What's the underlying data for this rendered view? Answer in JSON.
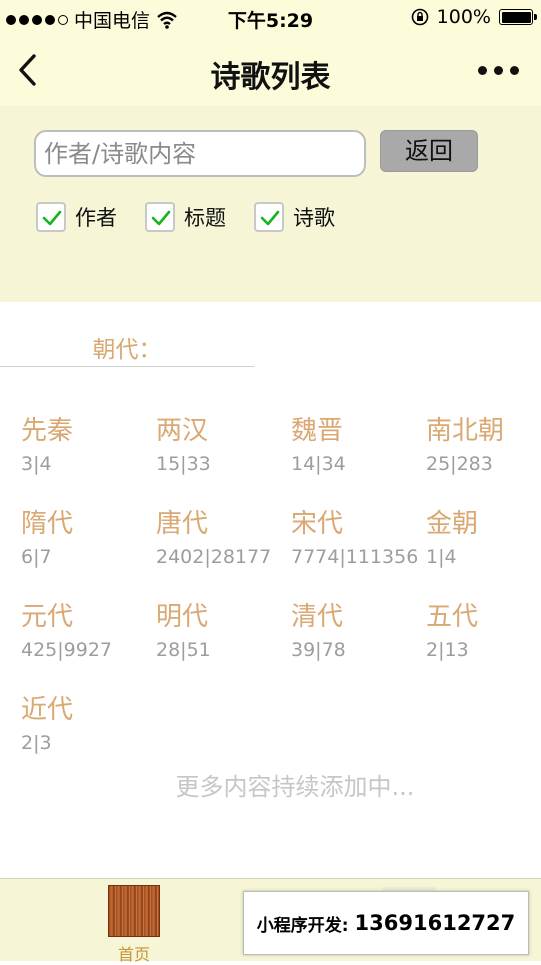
{
  "status_bar": {
    "carrier": "中国电信",
    "time": "下午5:29",
    "battery": "100%"
  },
  "nav": {
    "title": "诗歌列表"
  },
  "search": {
    "placeholder": "作者/诗歌内容",
    "value": "",
    "back_label": "返回"
  },
  "filters": [
    {
      "label": "作者",
      "checked": true
    },
    {
      "label": "标题",
      "checked": true
    },
    {
      "label": "诗歌",
      "checked": true
    }
  ],
  "dynasty": {
    "heading": "朝代：",
    "items": [
      {
        "name": "先秦",
        "count": "3|4"
      },
      {
        "name": "两汉",
        "count": "15|33"
      },
      {
        "name": "魏晋",
        "count": "14|34"
      },
      {
        "name": "南北朝",
        "count": "25|283"
      },
      {
        "name": "隋代",
        "count": "6|7"
      },
      {
        "name": "唐代",
        "count": "2402|28177"
      },
      {
        "name": "宋代",
        "count": "7774|111356"
      },
      {
        "name": "金朝",
        "count": "1|4"
      },
      {
        "name": "元代",
        "count": "425|9927"
      },
      {
        "name": "明代",
        "count": "28|51"
      },
      {
        "name": "清代",
        "count": "39|78"
      },
      {
        "name": "五代",
        "count": "2|13"
      },
      {
        "name": "近代",
        "count": "2|3"
      }
    ]
  },
  "footer_note": "更多内容持续添加中...",
  "tabbar": {
    "home_label": "首页"
  },
  "banner": {
    "prefix": "小程序开发:",
    "phone": "13691612727"
  },
  "colors": {
    "header_bg": "#fcfbda",
    "panel_bg": "#f6f5d6",
    "accent": "#d9a873",
    "count_text": "#9d9d9d"
  }
}
